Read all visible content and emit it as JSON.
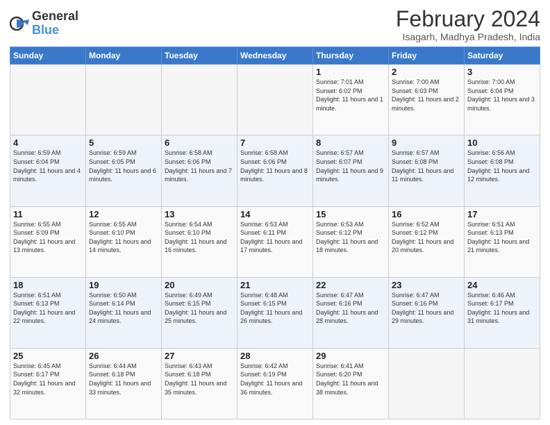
{
  "logo": {
    "general": "General",
    "blue": "Blue"
  },
  "title": "February 2024",
  "subtitle": "Isagarh, Madhya Pradesh, India",
  "days_of_week": [
    "Sunday",
    "Monday",
    "Tuesday",
    "Wednesday",
    "Thursday",
    "Friday",
    "Saturday"
  ],
  "weeks": [
    [
      {
        "day": "",
        "info": ""
      },
      {
        "day": "",
        "info": ""
      },
      {
        "day": "",
        "info": ""
      },
      {
        "day": "",
        "info": ""
      },
      {
        "day": "1",
        "info": "Sunrise: 7:01 AM\nSunset: 6:02 PM\nDaylight: 11 hours and 1 minute."
      },
      {
        "day": "2",
        "info": "Sunrise: 7:00 AM\nSunset: 6:03 PM\nDaylight: 11 hours and 2 minutes."
      },
      {
        "day": "3",
        "info": "Sunrise: 7:00 AM\nSunset: 6:04 PM\nDaylight: 11 hours and 3 minutes."
      }
    ],
    [
      {
        "day": "4",
        "info": "Sunrise: 6:59 AM\nSunset: 6:04 PM\nDaylight: 11 hours and 4 minutes."
      },
      {
        "day": "5",
        "info": "Sunrise: 6:59 AM\nSunset: 6:05 PM\nDaylight: 11 hours and 6 minutes."
      },
      {
        "day": "6",
        "info": "Sunrise: 6:58 AM\nSunset: 6:06 PM\nDaylight: 11 hours and 7 minutes."
      },
      {
        "day": "7",
        "info": "Sunrise: 6:58 AM\nSunset: 6:06 PM\nDaylight: 11 hours and 8 minutes."
      },
      {
        "day": "8",
        "info": "Sunrise: 6:57 AM\nSunset: 6:07 PM\nDaylight: 11 hours and 9 minutes."
      },
      {
        "day": "9",
        "info": "Sunrise: 6:57 AM\nSunset: 6:08 PM\nDaylight: 11 hours and 11 minutes."
      },
      {
        "day": "10",
        "info": "Sunrise: 6:56 AM\nSunset: 6:08 PM\nDaylight: 11 hours and 12 minutes."
      }
    ],
    [
      {
        "day": "11",
        "info": "Sunrise: 6:55 AM\nSunset: 6:09 PM\nDaylight: 11 hours and 13 minutes."
      },
      {
        "day": "12",
        "info": "Sunrise: 6:55 AM\nSunset: 6:10 PM\nDaylight: 11 hours and 14 minutes."
      },
      {
        "day": "13",
        "info": "Sunrise: 6:54 AM\nSunset: 6:10 PM\nDaylight: 11 hours and 16 minutes."
      },
      {
        "day": "14",
        "info": "Sunrise: 6:53 AM\nSunset: 6:11 PM\nDaylight: 11 hours and 17 minutes."
      },
      {
        "day": "15",
        "info": "Sunrise: 6:53 AM\nSunset: 6:12 PM\nDaylight: 11 hours and 18 minutes."
      },
      {
        "day": "16",
        "info": "Sunrise: 6:52 AM\nSunset: 6:12 PM\nDaylight: 11 hours and 20 minutes."
      },
      {
        "day": "17",
        "info": "Sunrise: 6:51 AM\nSunset: 6:13 PM\nDaylight: 11 hours and 21 minutes."
      }
    ],
    [
      {
        "day": "18",
        "info": "Sunrise: 6:51 AM\nSunset: 6:13 PM\nDaylight: 11 hours and 22 minutes."
      },
      {
        "day": "19",
        "info": "Sunrise: 6:50 AM\nSunset: 6:14 PM\nDaylight: 11 hours and 24 minutes."
      },
      {
        "day": "20",
        "info": "Sunrise: 6:49 AM\nSunset: 6:15 PM\nDaylight: 11 hours and 25 minutes."
      },
      {
        "day": "21",
        "info": "Sunrise: 6:48 AM\nSunset: 6:15 PM\nDaylight: 11 hours and 26 minutes."
      },
      {
        "day": "22",
        "info": "Sunrise: 6:47 AM\nSunset: 6:16 PM\nDaylight: 11 hours and 28 minutes."
      },
      {
        "day": "23",
        "info": "Sunrise: 6:47 AM\nSunset: 6:16 PM\nDaylight: 11 hours and 29 minutes."
      },
      {
        "day": "24",
        "info": "Sunrise: 6:46 AM\nSunset: 6:17 PM\nDaylight: 11 hours and 31 minutes."
      }
    ],
    [
      {
        "day": "25",
        "info": "Sunrise: 6:45 AM\nSunset: 6:17 PM\nDaylight: 11 hours and 32 minutes."
      },
      {
        "day": "26",
        "info": "Sunrise: 6:44 AM\nSunset: 6:18 PM\nDaylight: 11 hours and 33 minutes."
      },
      {
        "day": "27",
        "info": "Sunrise: 6:43 AM\nSunset: 6:18 PM\nDaylight: 11 hours and 35 minutes."
      },
      {
        "day": "28",
        "info": "Sunrise: 6:42 AM\nSunset: 6:19 PM\nDaylight: 11 hours and 36 minutes."
      },
      {
        "day": "29",
        "info": "Sunrise: 6:41 AM\nSunset: 6:20 PM\nDaylight: 11 hours and 38 minutes."
      },
      {
        "day": "",
        "info": ""
      },
      {
        "day": "",
        "info": ""
      }
    ]
  ]
}
